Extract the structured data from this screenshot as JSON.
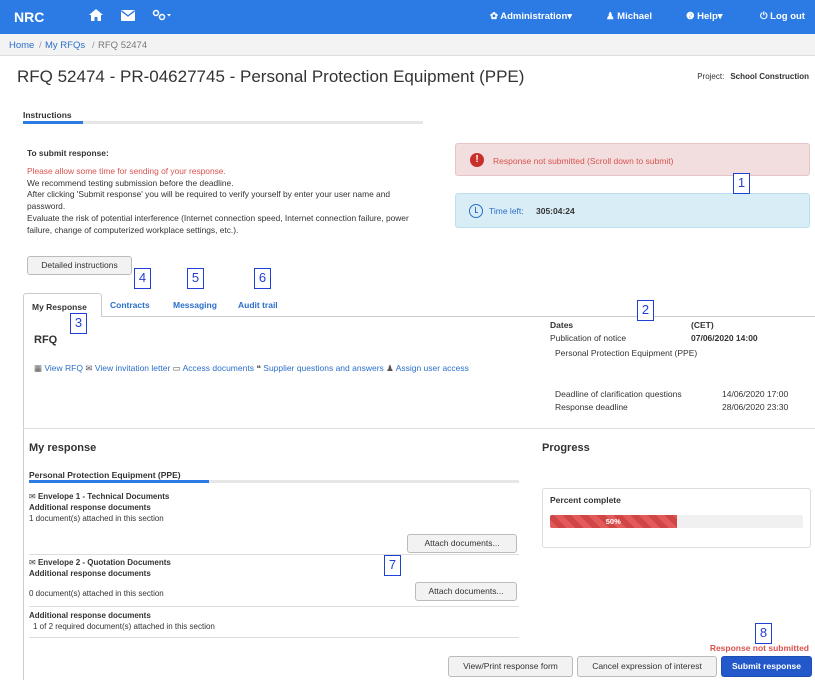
{
  "topbar": {
    "brand": "NRC",
    "icons": [
      "home-icon",
      "envelope-icon",
      "link-icon"
    ],
    "admin_label": "✿ Administration▾",
    "user_label": "♟ Michael",
    "help_label": "❷ Help▾",
    "logout_label": "⏻ Log out",
    "color": "#2c7be5"
  },
  "breadcrumb": {
    "home": "Home",
    "my_rfqs": "My RFQs",
    "current": "RFQ  52474"
  },
  "page": {
    "title": "RFQ  52474 - PR-04627745 - Personal Protection Equipment (PPE)",
    "project_label": "Project:",
    "project_value": "School Construction"
  },
  "instructions": {
    "tab": "Instructions",
    "heading": "To submit response:",
    "line_red": "Please allow some time for sending of your response.",
    "line1": "We recommend testing submission before the deadline.",
    "line2": "After clicking 'Submit response' you will be required to verify yourself by enter your user name and password.",
    "line3": "Evaluate the risk of potential interference (Internet connection speed, Internet connection failure, power failure, change of computerized workplace settings, etc.).",
    "detailed_button": "Detailed instructions"
  },
  "alerts": {
    "not_submitted": "Response not submitted (Scroll down to submit)",
    "time_left_label": "Time left:",
    "time_left_value": "305:04:24"
  },
  "tabs": {
    "my_response": "My Response",
    "contracts": "Contracts",
    "messaging": "Messaging",
    "audit_trail": "Audit trail"
  },
  "rfq": {
    "title": "RFQ",
    "view_rfq": "View RFQ",
    "view_invitation": "View invitation letter",
    "access_documents": "Access documents",
    "supplier_qa": "Supplier questions and answers",
    "assign_user": "Assign user access"
  },
  "dates": {
    "header": "Dates",
    "tz": "(CET)",
    "publication_label": "Publication of notice",
    "publication_value": "07/06/2020 14:00",
    "item_name": "Personal Protection Equipment (PPE)",
    "clarification_label": "Deadline of clarification questions",
    "clarification_value": "14/06/2020 17:00",
    "response_label": "Response deadline",
    "response_value": "28/06/2020 23:30"
  },
  "my_response": {
    "heading": "My response",
    "ppe_tab": "Personal Protection Equipment (PPE)",
    "env1_title": "Envelope 1 - Technical Documents",
    "env1_sub": "Additional response documents",
    "env1_count": "1 document(s) attached in this section",
    "env2_title": "Envelope 2 - Quotation Documents",
    "env2_sub": "Additional response documents",
    "env2_count": "0  document(s) attached in this section",
    "add_title": "Additional response documents",
    "add_count": "1  of 2 required document(s) attached in this section",
    "attach_button": "Attach documents..."
  },
  "progress": {
    "heading": "Progress",
    "label": "Percent complete",
    "percent": 50,
    "percent_text": "50%"
  },
  "footer": {
    "status": "Response not submitted",
    "view_print": "View/Print response form",
    "cancel": "Cancel expression of interest",
    "submit": "Submit response"
  },
  "markers": [
    "1",
    "2",
    "3",
    "4",
    "5",
    "6",
    "7",
    "8"
  ]
}
